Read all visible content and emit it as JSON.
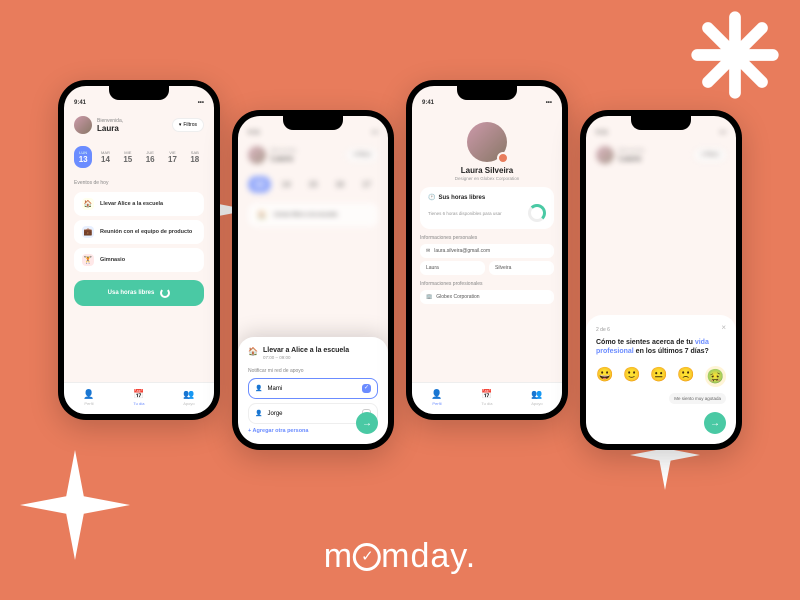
{
  "brand": "momday.",
  "colors": {
    "bg": "#e87c5c",
    "accent": "#6b8cff",
    "cta": "#4ac9a4"
  },
  "phone1": {
    "status_time": "9:41",
    "welcome": "Bienvenida,",
    "name": "Laura",
    "filter_label": "Filtros",
    "dates": [
      {
        "day": "LUN",
        "num": "13",
        "selected": true
      },
      {
        "day": "MAR",
        "num": "14"
      },
      {
        "day": "MIE",
        "num": "15"
      },
      {
        "day": "JUE",
        "num": "16"
      },
      {
        "day": "VIE",
        "num": "17"
      },
      {
        "day": "SAB",
        "num": "18"
      }
    ],
    "events_title": "Eventos de hoy",
    "events": [
      {
        "icon": "🏠",
        "label": "Llevar Alice a la escuela"
      },
      {
        "icon": "💼",
        "label": "Reunión con el equipo de producto"
      },
      {
        "icon": "🏋️",
        "label": "Gimnasio"
      }
    ],
    "cta_label": "Usa horas libres",
    "tabs": [
      {
        "icon": "👤",
        "label": "Perfil"
      },
      {
        "icon": "📅",
        "label": "Tu día",
        "active": true
      },
      {
        "icon": "👥",
        "label": "Apoyo"
      }
    ]
  },
  "phone2": {
    "status_time": "9:41",
    "sheet_title": "Llevar a Alice a la escuela",
    "sheet_time": "07:00 – 09:00",
    "notify_label": "Notificar mi red de apoyo",
    "people": [
      {
        "icon": "👤",
        "name": "Mami",
        "selected": true
      },
      {
        "icon": "👤",
        "name": "Jorge",
        "selected": false
      }
    ],
    "add_person": "+ Agregar otra persona",
    "next_icon": "→"
  },
  "phone3": {
    "status_time": "9:41",
    "name": "Laura Silveira",
    "subtitle": "Designer en Globex Corporation",
    "free_title": "Sus horas libres",
    "free_sub": "Tienes 6 horas disponibles para usar",
    "section_personal": "Informaciones personales",
    "email": "laura.silveira@gmail.com",
    "first_name": "Laura",
    "last_name": "Silveira",
    "section_prof": "Informaciones profesionales",
    "company": "Globex Corporation",
    "tabs": [
      {
        "icon": "👤",
        "label": "Perfil",
        "active": true
      },
      {
        "icon": "📅",
        "label": "Tu día"
      },
      {
        "icon": "👥",
        "label": "Apoyo"
      }
    ]
  },
  "phone4": {
    "status_time": "9:41",
    "step": "2 de 6",
    "question_pre": "Cómo te sientes acerca de tu ",
    "question_hl": "vida profesional",
    "question_post": " en los últimos 7 días?",
    "emojis": [
      "😀",
      "🙂",
      "😐",
      "🙁",
      "🤢"
    ],
    "selected_emoji_index": 4,
    "caption": "Me siento muy agotada",
    "next_icon": "→"
  }
}
